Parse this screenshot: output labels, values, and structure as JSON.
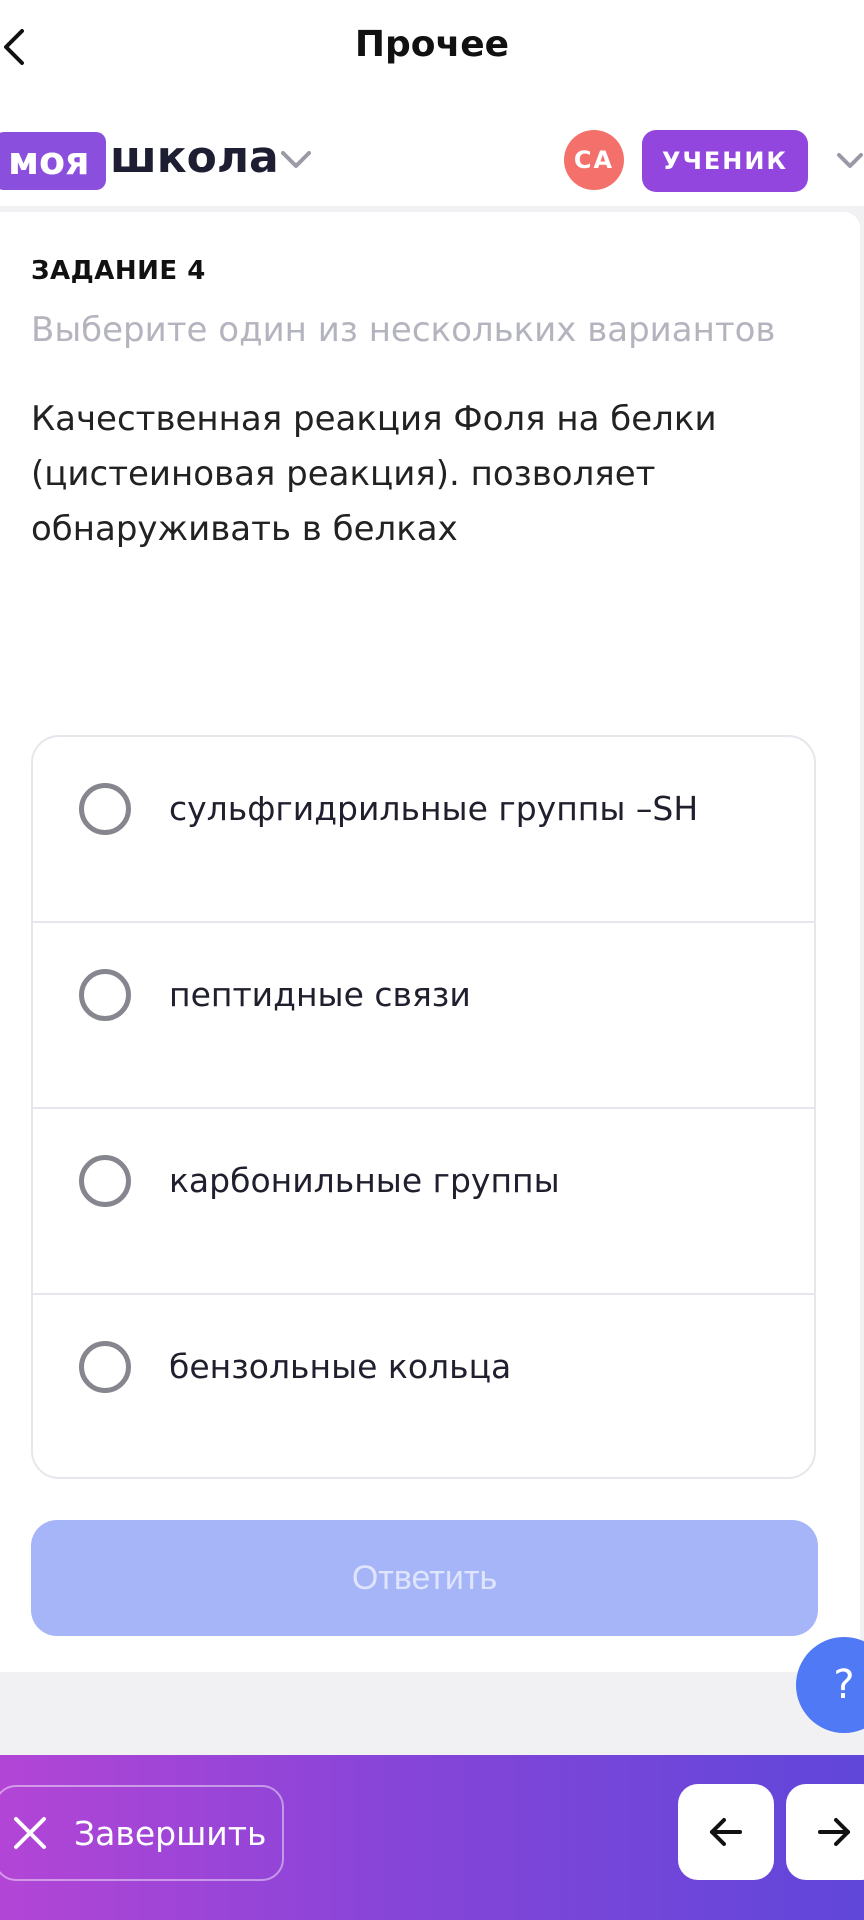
{
  "header": {
    "title": "Прочее",
    "logo_pill": "моя",
    "logo_word": "школа",
    "avatar_initials": "СА",
    "role": "УЧЕНИК"
  },
  "task": {
    "label": "ЗАДАНИЕ 4",
    "hint": "Выберите один из нескольких вариантов",
    "question": "Качественная реакция Фоля на белки (цистеиновая реакция). позволяет обнаруживать в белках"
  },
  "options": [
    {
      "text": "сульфгидрильные группы –SH"
    },
    {
      "text": "пептидные связи"
    },
    {
      "text": "карбонильные группы"
    },
    {
      "text": "бензольные кольца"
    }
  ],
  "answer_button": "Ответить",
  "help_button": "?",
  "footer": {
    "finish_label": "Завершить"
  },
  "icons": {
    "back": "chevron-left-icon",
    "dropdown": "chevron-down-icon",
    "finish": "close-icon",
    "prev": "arrow-left-icon",
    "next": "arrow-right-icon"
  },
  "colors": {
    "brand_purple": "#8a4fdc",
    "avatar_red": "#f4706a",
    "answer_disabled": "#a6b5f8",
    "help_blue": "#4f79f5"
  }
}
